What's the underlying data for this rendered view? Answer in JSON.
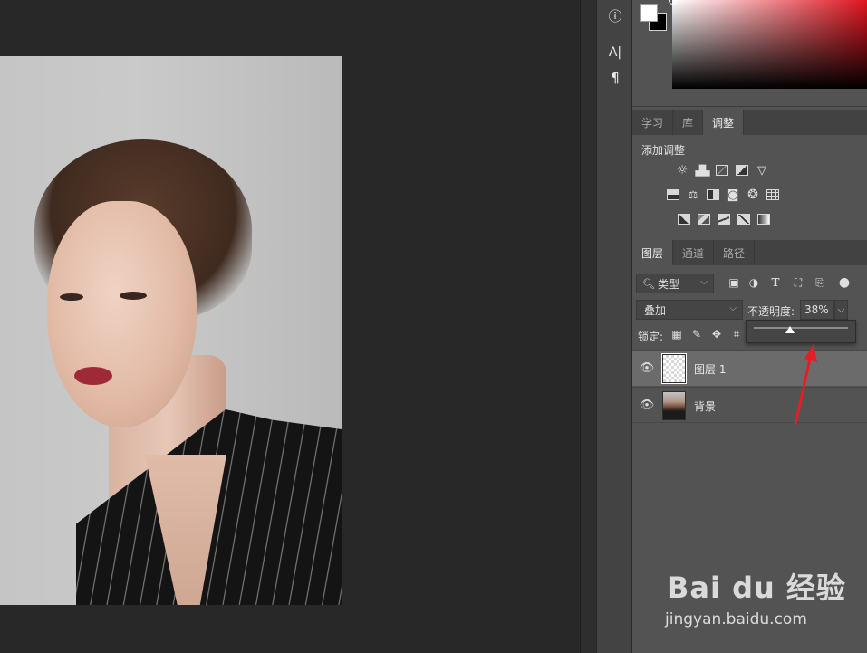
{
  "colors": {
    "panel_bg": "#535353",
    "canvas_bg": "#282828",
    "accent_arrow": "#e31e24",
    "foreground": "#ffffff",
    "background": "#000000"
  },
  "toolbar": {
    "tools": [
      {
        "name": "info-icon",
        "glyph": "ⓘ"
      },
      {
        "name": "character-icon",
        "glyph": "A|"
      },
      {
        "name": "paragraph-icon",
        "glyph": "¶"
      }
    ]
  },
  "adjust_tabs": [
    {
      "label": "学习",
      "active": false
    },
    {
      "label": "库",
      "active": false
    },
    {
      "label": "调整",
      "active": true
    }
  ],
  "adjustments": {
    "title": "添加调整",
    "row1": [
      "brightness-contrast-icon",
      "levels-icon",
      "curves-icon",
      "exposure-icon",
      "vibrance-icon"
    ],
    "row2": [
      "hue-saturation-icon",
      "color-balance-icon",
      "black-white-icon",
      "photo-filter-icon",
      "channel-mixer-icon",
      "color-lookup-icon"
    ],
    "row3": [
      "invert-icon",
      "posterize-icon",
      "threshold-icon",
      "selective-color-icon",
      "gradient-map-icon"
    ]
  },
  "layers_tabs": [
    {
      "label": "图层",
      "active": true
    },
    {
      "label": "通道",
      "active": false
    },
    {
      "label": "路径",
      "active": false
    }
  ],
  "layers": {
    "filter_label": "类型",
    "filter_icons": [
      "image-filter-icon",
      "adjustment-filter-icon",
      "type-filter-icon",
      "shape-filter-icon",
      "smart-object-filter-icon",
      "filter-toggle-icon"
    ],
    "blend_mode": "叠加",
    "opacity_label": "不透明度:",
    "opacity_value": "38%",
    "opacity_slider_fraction": 0.38,
    "lock_label": "锁定:",
    "items": [
      {
        "name": "图层 1",
        "visible": true,
        "selected": true,
        "thumb": "transparent"
      },
      {
        "name": "背景",
        "visible": true,
        "selected": false,
        "thumb": "photo"
      }
    ]
  },
  "watermark": {
    "brand": "Bai du 经验",
    "url": "jingyan.baidu.com"
  }
}
